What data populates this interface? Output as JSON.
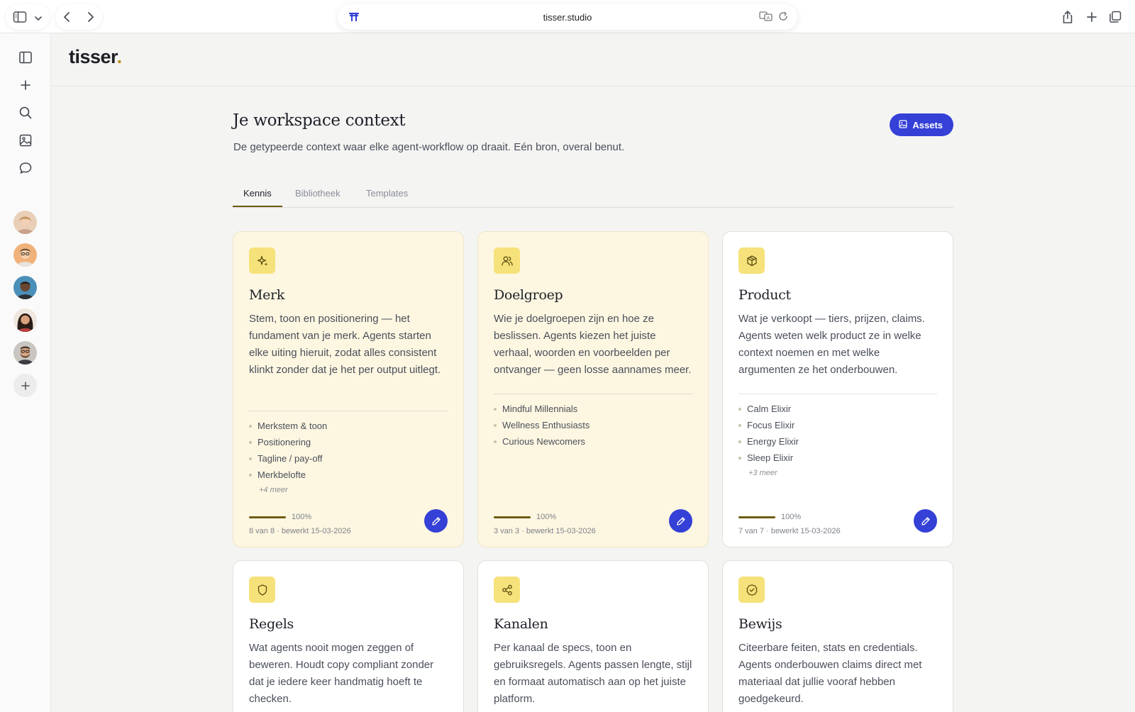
{
  "browser": {
    "url": "tisser.studio"
  },
  "brand": {
    "logo_text": "tisser",
    "logo_dot": ".",
    "accent": "#3440d6",
    "card_highlight": "#fdf6e1",
    "icon_bg": "#f6e27a"
  },
  "header": {
    "title": "Je workspace context",
    "subtitle": "De getypeerde context waar elke agent-workflow op draait. Eén bron, overal benut.",
    "assets_label": "Assets"
  },
  "tabs": [
    {
      "label": "Kennis",
      "active": true
    },
    {
      "label": "Bibliotheek",
      "active": false
    },
    {
      "label": "Templates",
      "active": false
    }
  ],
  "rail": {
    "icons": [
      "sidebar-icon",
      "plus-icon",
      "search-icon",
      "image-icon",
      "chat-icon"
    ],
    "avatars": 5
  },
  "cards": [
    {
      "title": "Merk",
      "icon": "sparkle-icon",
      "filled": true,
      "description": "Stem, toon en positionering — het fundament van je merk. Agents starten elke uiting hieruit, zodat alles consistent klinkt zonder dat je het per output uitlegt.",
      "items": [
        "Merkstem & toon",
        "Positionering",
        "Tagline / pay-off",
        "Merkbelofte"
      ],
      "more": "+4 meer",
      "progress_value": 1.0,
      "progress": "100%",
      "meta": "8 van 8 · bewerkt 15-03-2026"
    },
    {
      "title": "Doelgroep",
      "icon": "users-icon",
      "filled": true,
      "description": "Wie je doelgroepen zijn en hoe ze beslissen. Agents kiezen het juiste verhaal, woorden en voorbeelden per ontvanger — geen losse aannames meer.",
      "items": [
        "Mindful Millennials",
        "Wellness Enthusiasts",
        "Curious Newcomers"
      ],
      "more": "",
      "progress_value": 1.0,
      "progress": "100%",
      "meta": "3 van 3 · bewerkt 15-03-2026"
    },
    {
      "title": "Product",
      "icon": "box-icon",
      "filled": false,
      "description": "Wat je verkoopt — tiers, prijzen, claims. Agents weten welk product ze in welke context noemen en met welke argumenten ze het onderbouwen.",
      "items": [
        "Calm Elixir",
        "Focus Elixir",
        "Energy Elixir",
        "Sleep Elixir"
      ],
      "more": "+3 meer",
      "progress_value": 1.0,
      "progress": "100%",
      "meta": "7 van 7 · bewerkt 15-03-2026"
    },
    {
      "title": "Regels",
      "icon": "shield-icon",
      "filled": false,
      "description": "Wat agents nooit mogen zeggen of beweren. Houdt copy compliant zonder dat je iedere keer handmatig hoeft te checken."
    },
    {
      "title": "Kanalen",
      "icon": "share-icon",
      "filled": false,
      "description": "Per kanaal de specs, toon en gebruiksregels. Agents passen lengte, stijl en formaat automatisch aan op het juiste platform."
    },
    {
      "title": "Bewijs",
      "icon": "badge-check-icon",
      "filled": false,
      "description": "Citeerbare feiten, stats en credentials. Agents onderbouwen claims direct met materiaal dat jullie vooraf hebben goedgekeurd."
    }
  ]
}
